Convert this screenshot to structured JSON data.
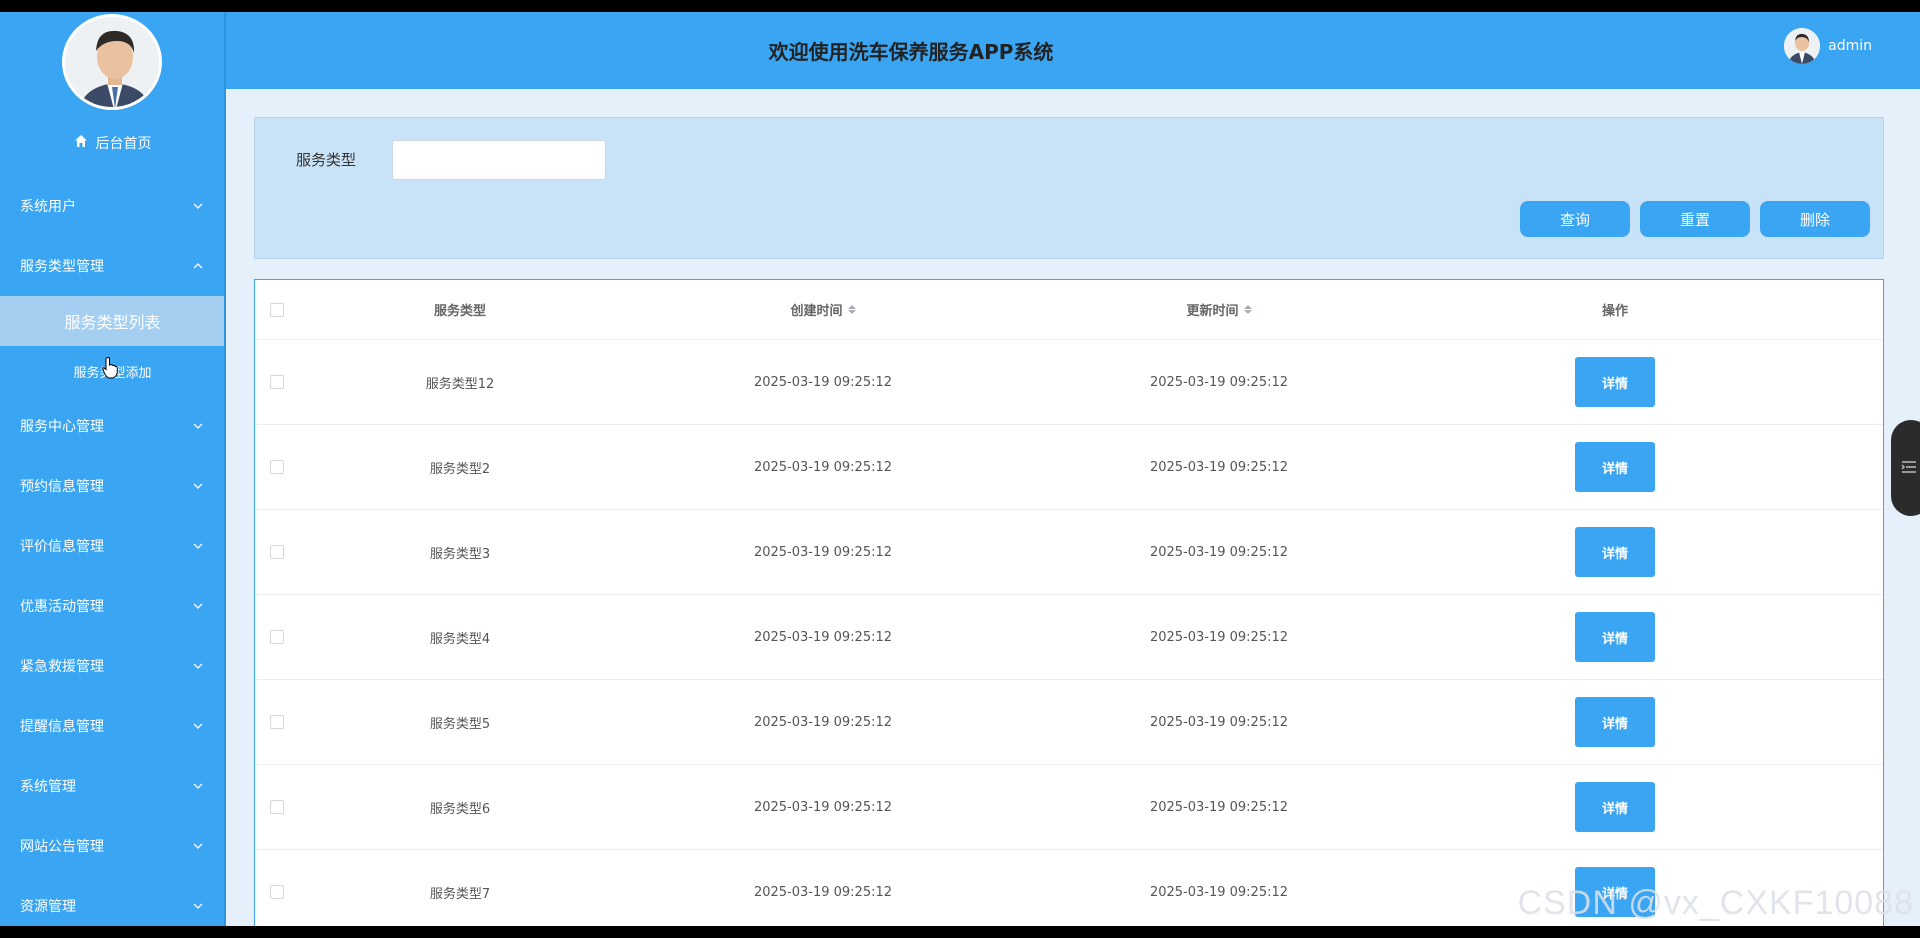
{
  "header": {
    "title": "欢迎使用洗车保养服务APP系统",
    "username": "admin"
  },
  "sidebar": {
    "home_label": "后台首页",
    "menu_before": [
      {
        "label": "系统用户",
        "expanded": false
      },
      {
        "label": "服务类型管理",
        "expanded": true
      }
    ],
    "submenu": {
      "active_label": "服务类型列表",
      "add_label": "服务类型添加"
    },
    "menu_after": [
      {
        "label": "服务中心管理"
      },
      {
        "label": "预约信息管理"
      },
      {
        "label": "评价信息管理"
      },
      {
        "label": "优惠活动管理"
      },
      {
        "label": "紧急救援管理"
      },
      {
        "label": "提醒信息管理"
      },
      {
        "label": "系统管理"
      },
      {
        "label": "网站公告管理"
      },
      {
        "label": "资源管理"
      }
    ]
  },
  "search": {
    "label": "服务类型",
    "value": "",
    "query_label": "查询",
    "reset_label": "重置",
    "delete_label": "删除"
  },
  "table": {
    "columns": {
      "type": "服务类型",
      "created": "创建时间",
      "updated": "更新时间",
      "operation": "操作"
    },
    "detail_label": "详情",
    "rows": [
      {
        "type": "服务类型12",
        "created": "2025-03-19 09:25:12",
        "updated": "2025-03-19 09:25:12"
      },
      {
        "type": "服务类型2",
        "created": "2025-03-19 09:25:12",
        "updated": "2025-03-19 09:25:12"
      },
      {
        "type": "服务类型3",
        "created": "2025-03-19 09:25:12",
        "updated": "2025-03-19 09:25:12"
      },
      {
        "type": "服务类型4",
        "created": "2025-03-19 09:25:12",
        "updated": "2025-03-19 09:25:12"
      },
      {
        "type": "服务类型5",
        "created": "2025-03-19 09:25:12",
        "updated": "2025-03-19 09:25:12"
      },
      {
        "type": "服务类型6",
        "created": "2025-03-19 09:25:12",
        "updated": "2025-03-19 09:25:12"
      },
      {
        "type": "服务类型7",
        "created": "2025-03-19 09:25:12",
        "updated": "2025-03-19 09:25:12"
      }
    ]
  },
  "watermark": "CSDN @vx_CXKF10088",
  "colors": {
    "primary": "#3aa5f2",
    "sidebar_active": "#a5cff1",
    "search_panel": "#c8e2f7"
  }
}
